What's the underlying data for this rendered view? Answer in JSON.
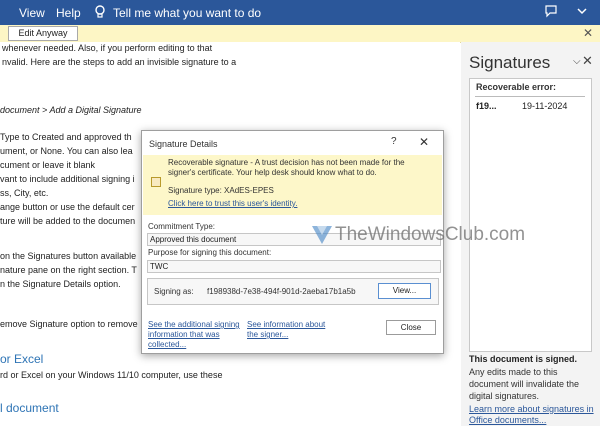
{
  "topbar": {
    "menu": [
      "View",
      "Help"
    ],
    "tell_me": "Tell me what you want to do"
  },
  "infobar": {
    "edit_anyway": "Edit Anyway"
  },
  "doc": {
    "lines": [
      "whenever needed. Also, if you perform editing to that",
      "nvalid. Here are the steps to add an invisible signature to a",
      "document > Add a Digital Signature",
      "Type to Created and approved th",
      "ument, or None. You can also lea",
      "cument or leave it blank",
      "vant to include additional signing i",
      "ss, City, etc.",
      "ange button or use the default cer",
      "ture will be added to the documen",
      "on the Signatures button available",
      "nature pane on the right section. T",
      "n the Signature Details option.",
      "emove Signature option to remove",
      "or Excel",
      "rd or Excel on your Windows 11/10 computer, use these",
      "l document"
    ]
  },
  "pane": {
    "title": "Signatures",
    "error_heading": "Recoverable error:",
    "signer": "f19...",
    "date": "19-11-2024",
    "signed_heading": "This document is signed.",
    "signed_desc": "Any edits made to this document will invalidate the digital signatures.",
    "learn_more": "Learn more about signatures in Office documents..."
  },
  "dialog": {
    "title": "Signature Details",
    "help": "?",
    "warning": "Recoverable signature - A trust decision has not been made for the signer's certificate.  Your help desk should know what to do.",
    "signature_type": "Signature type: XAdES-EPES",
    "trust_link": "Click here to trust this user's identity.",
    "commitment_label": "Commitment Type:",
    "commitment_value": "Approved this document",
    "purpose_label": "Purpose for signing this document:",
    "purpose_value": "TWC",
    "signing_as_label": "Signing as:",
    "signing_as_value": "f198938d-7e38-494f-901d-2aeba17b1a5b",
    "view_button": "View...",
    "additional_link": "See the additional signing information that was collected...",
    "signer_link": "See information about the signer...",
    "close_button": "Close"
  },
  "watermark": {
    "text": "TheWindowsClub.com"
  },
  "colors": {
    "ribbon": "#2b579a",
    "warning": "#fdf7c9",
    "link": "#2b579a"
  }
}
